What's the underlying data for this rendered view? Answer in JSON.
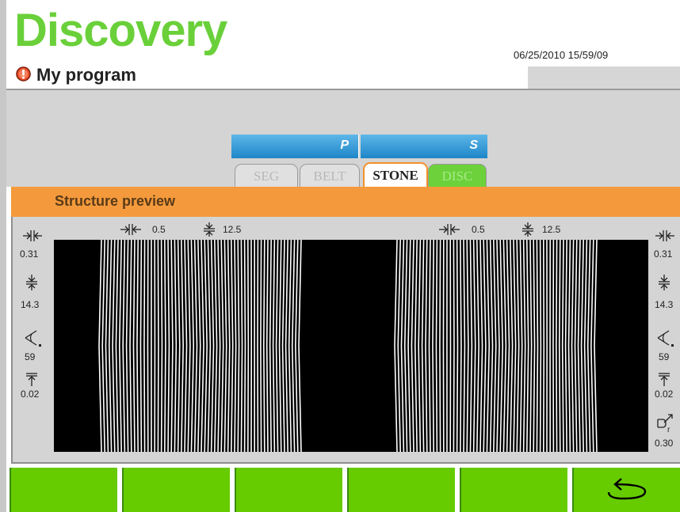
{
  "header": {
    "app_title": "Discovery",
    "program_name": "My program",
    "datetime": "06/25/2010 15/59/09"
  },
  "tabs": {
    "group_p_label": "P",
    "group_s_label": "S",
    "items": [
      {
        "label": "SEG",
        "state": "disabled"
      },
      {
        "label": "BELT",
        "state": "disabled"
      },
      {
        "label": "STONE",
        "state": "active"
      },
      {
        "label": "DISC",
        "state": "disabled"
      }
    ]
  },
  "section": {
    "title": "Structure preview"
  },
  "preview": {
    "top_left": {
      "spacing": "0.5",
      "height": "12.5"
    },
    "top_right": {
      "spacing": "0.5",
      "height": "12.5"
    },
    "left_params": {
      "width": "0.31",
      "depth": "14.3",
      "angle": "59",
      "offset": "0.02"
    },
    "right_params": {
      "width": "0.31",
      "depth": "14.3",
      "angle": "59",
      "offset": "0.02",
      "radius": "0.30"
    }
  },
  "colors": {
    "brand_green": "#6ad03a",
    "tab_blue": "#1e86c8",
    "accent_orange": "#f49a3c",
    "softkey_green": "#66cc00"
  },
  "icons": {
    "info": "info-icon",
    "back": "back-arrow-icon"
  }
}
